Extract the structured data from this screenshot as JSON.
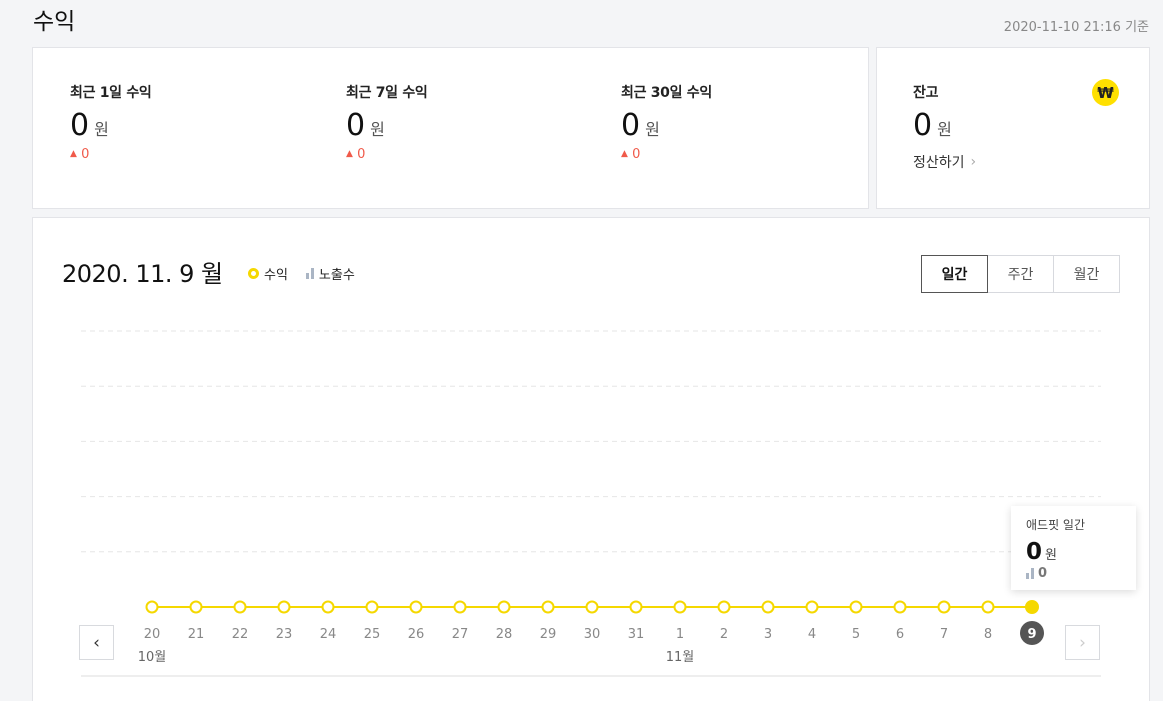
{
  "page": {
    "title": "수익",
    "basis": "2020-11-10 21:16 기준"
  },
  "summary": {
    "items": [
      {
        "label": "최근 1일 수익",
        "value": "0",
        "unit": "원",
        "delta": "0"
      },
      {
        "label": "최근 7일 수익",
        "value": "0",
        "unit": "원",
        "delta": "0"
      },
      {
        "label": "최근 30일 수익",
        "value": "0",
        "unit": "원",
        "delta": "0"
      }
    ],
    "delta_arrow": "▲"
  },
  "balance": {
    "label": "잔고",
    "value": "0",
    "unit": "원",
    "settle_label": "정산하기",
    "icon_glyph": "₩",
    "icon_color": "#ffe000"
  },
  "chart_header": {
    "date": "2020. 11. 9 월",
    "legend": {
      "revenue": "수익",
      "impressions": "노출수"
    },
    "tabs": [
      "일간",
      "주간",
      "월간"
    ],
    "active_tab": 0
  },
  "tooltip": {
    "title": "애드핏 일간",
    "value": "0",
    "unit": "원",
    "impressions": "0"
  },
  "nav": {
    "prev_glyph": "‹",
    "next_glyph": "›"
  },
  "colors": {
    "line": "#f5d800",
    "grid": "#e6e6e6",
    "selected_badge": "#555555",
    "delta": "#f05a4a"
  },
  "chart_data": {
    "type": "line",
    "x": [
      "20",
      "21",
      "22",
      "23",
      "24",
      "25",
      "26",
      "27",
      "28",
      "29",
      "30",
      "31",
      "1",
      "2",
      "3",
      "4",
      "5",
      "6",
      "7",
      "8",
      "9"
    ],
    "month_labels": [
      {
        "index": 0,
        "text": "10월"
      },
      {
        "index": 12,
        "text": "11월"
      }
    ],
    "series": [
      {
        "name": "수익",
        "values": [
          0,
          0,
          0,
          0,
          0,
          0,
          0,
          0,
          0,
          0,
          0,
          0,
          0,
          0,
          0,
          0,
          0,
          0,
          0,
          0,
          0
        ]
      },
      {
        "name": "노출수",
        "values": [
          0,
          0,
          0,
          0,
          0,
          0,
          0,
          0,
          0,
          0,
          0,
          0,
          0,
          0,
          0,
          0,
          0,
          0,
          0,
          0,
          0
        ]
      }
    ],
    "selected_index": 20,
    "grid": true,
    "ylim": [
      0,
      1
    ]
  }
}
